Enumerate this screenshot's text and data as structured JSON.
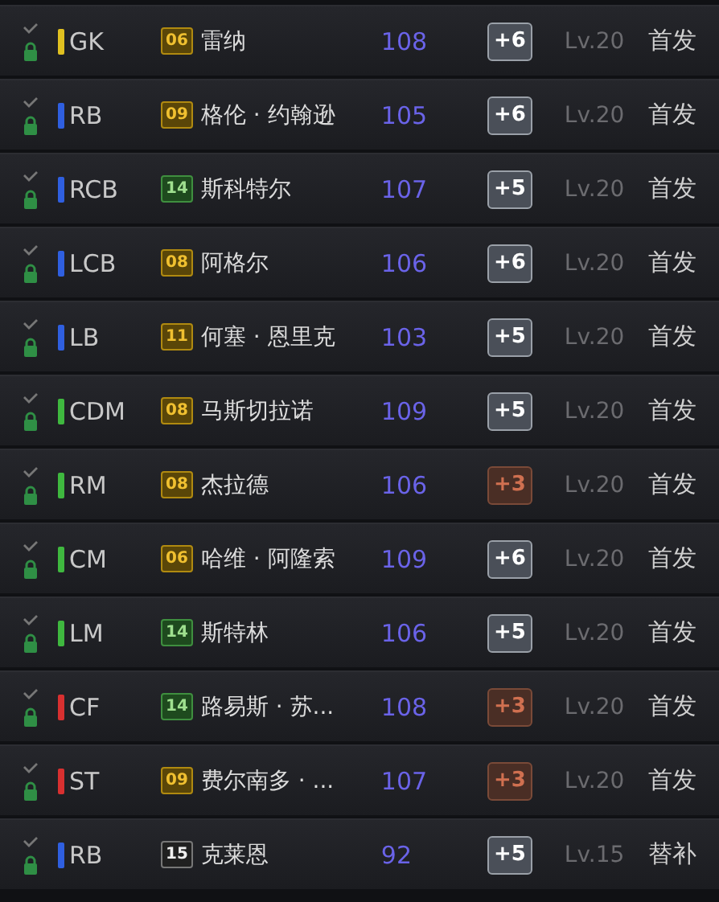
{
  "rows": [
    {
      "position": "GK",
      "color": "#e0c020",
      "number": {
        "text": "06",
        "kind": "gold"
      },
      "name": "雷纳",
      "rating": "108",
      "boost": {
        "text": "+6",
        "kind": "silver"
      },
      "level": "Lv.20",
      "status": "首发"
    },
    {
      "position": "RB",
      "color": "#2f5fe0",
      "number": {
        "text": "09",
        "kind": "gold"
      },
      "name": "格伦 · 约翰逊",
      "rating": "105",
      "boost": {
        "text": "+6",
        "kind": "silver"
      },
      "level": "Lv.20",
      "status": "首发"
    },
    {
      "position": "RCB",
      "color": "#2f5fe0",
      "number": {
        "text": "14",
        "kind": "green"
      },
      "name": "斯科特尔",
      "rating": "107",
      "boost": {
        "text": "+5",
        "kind": "silver"
      },
      "level": "Lv.20",
      "status": "首发"
    },
    {
      "position": "LCB",
      "color": "#2f5fe0",
      "number": {
        "text": "08",
        "kind": "gold"
      },
      "name": "阿格尔",
      "rating": "106",
      "boost": {
        "text": "+6",
        "kind": "silver"
      },
      "level": "Lv.20",
      "status": "首发"
    },
    {
      "position": "LB",
      "color": "#2f5fe0",
      "number": {
        "text": "11",
        "kind": "gold"
      },
      "name": "何塞 · 恩里克",
      "rating": "103",
      "boost": {
        "text": "+5",
        "kind": "silver"
      },
      "level": "Lv.20",
      "status": "首发"
    },
    {
      "position": "CDM",
      "color": "#3fb83f",
      "number": {
        "text": "08",
        "kind": "gold"
      },
      "name": "马斯切拉诺",
      "rating": "109",
      "boost": {
        "text": "+5",
        "kind": "silver"
      },
      "level": "Lv.20",
      "status": "首发"
    },
    {
      "position": "RM",
      "color": "#3fb83f",
      "number": {
        "text": "08",
        "kind": "gold"
      },
      "name": "杰拉德",
      "rating": "106",
      "boost": {
        "text": "+3",
        "kind": "bronze"
      },
      "level": "Lv.20",
      "status": "首发"
    },
    {
      "position": "CM",
      "color": "#3fb83f",
      "number": {
        "text": "06",
        "kind": "gold"
      },
      "name": "哈维 · 阿隆索",
      "rating": "109",
      "boost": {
        "text": "+6",
        "kind": "silver"
      },
      "level": "Lv.20",
      "status": "首发"
    },
    {
      "position": "LM",
      "color": "#3fb83f",
      "number": {
        "text": "14",
        "kind": "green"
      },
      "name": "斯特林",
      "rating": "106",
      "boost": {
        "text": "+5",
        "kind": "silver"
      },
      "level": "Lv.20",
      "status": "首发"
    },
    {
      "position": "CF",
      "color": "#d83030",
      "number": {
        "text": "14",
        "kind": "green"
      },
      "name": "路易斯 · 苏...",
      "rating": "108",
      "boost": {
        "text": "+3",
        "kind": "bronze"
      },
      "level": "Lv.20",
      "status": "首发"
    },
    {
      "position": "ST",
      "color": "#d83030",
      "number": {
        "text": "09",
        "kind": "gold"
      },
      "name": "费尔南多 · ...",
      "rating": "107",
      "boost": {
        "text": "+3",
        "kind": "bronze"
      },
      "level": "Lv.20",
      "status": "首发"
    },
    {
      "position": "RB",
      "color": "#2f5fe0",
      "number": {
        "text": "15",
        "kind": "white"
      },
      "name": "克莱恩",
      "rating": "92",
      "boost": {
        "text": "+5",
        "kind": "silver"
      },
      "level": "Lv.15",
      "status": "替补"
    }
  ]
}
